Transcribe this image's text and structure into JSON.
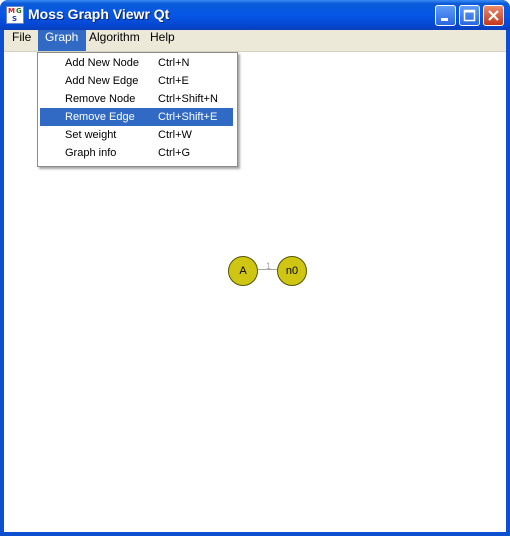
{
  "window": {
    "title": "Moss Graph Viewr Qt",
    "icon_letters": [
      "M",
      "G",
      "S"
    ],
    "controls": [
      "minimize-icon",
      "maximize-icon",
      "close-icon"
    ]
  },
  "menubar": {
    "items": [
      {
        "label": "File"
      },
      {
        "label": "Graph"
      },
      {
        "label": "Algorithm"
      },
      {
        "label": "Help"
      }
    ]
  },
  "graph_menu": {
    "items": [
      {
        "label": "Add New Node",
        "shortcut": "Ctrl+N"
      },
      {
        "label": "Add New Edge",
        "shortcut": "Ctrl+E"
      },
      {
        "label": "Remove Node",
        "shortcut": "Ctrl+Shift+N"
      },
      {
        "label": "Remove Edge",
        "shortcut": "Ctrl+Shift+E"
      },
      {
        "label": "Set weight",
        "shortcut": "Ctrl+W"
      },
      {
        "label": "Graph info",
        "shortcut": "Ctrl+G"
      }
    ],
    "highlighted": "Remove Edge"
  },
  "graph": {
    "nodes": [
      {
        "label": "A"
      },
      {
        "label": "n0"
      }
    ],
    "edges": [
      {
        "from": "A",
        "to": "n0",
        "weight": "1"
      }
    ]
  },
  "colors": {
    "node_fill": "#cfc513",
    "selection": "#316ac5",
    "titlebar": "#0656e6"
  }
}
